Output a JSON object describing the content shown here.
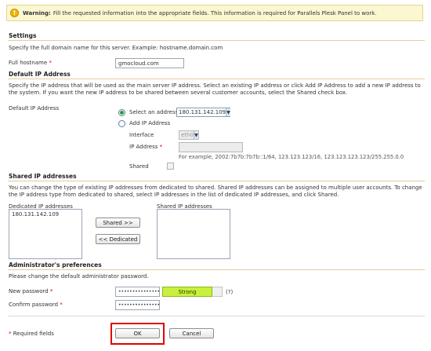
{
  "warning": {
    "title": "Warning:",
    "text": "Fill the requested information into the appropriate fields. This information is required for Parallels Plesk Panel to work."
  },
  "settings": {
    "title": "Settings",
    "description": "Specify the full domain name for this server. Example: hostname.domain.com",
    "hostname_label": "Full hostname",
    "hostname_value": "gmocloud.com"
  },
  "default_ip": {
    "title": "Default IP Address",
    "description": "Specify the IP address that will be used as the main server IP address. Select an existing IP address or click Add IP Address to add a new IP address to the system. If you want the new IP address to be shared between several customer accounts, select the Shared check box.",
    "label": "Default IP Address",
    "select_option_label": "Select an address",
    "selected_address": "180.131.142.109",
    "add_option_label": "Add IP Address",
    "interface_label": "Interface",
    "interface_value": "eth0",
    "ip_label": "IP Address",
    "ip_example": "For example, 2002:7b7b:7b7b::1/64, 123.123.123/16, 123.123.123.123/255.255.0.0",
    "shared_label": "Shared"
  },
  "shared_ips": {
    "title": "Shared IP addresses",
    "description": "You can change the type of existing IP addresses from dedicated to shared. Shared IP addresses can be assigned to multiple user accounts. To change the IP address type from dedicated to shared, select IP addresses in the list of dedicated IP addresses, and click Shared.",
    "dedicated_label": "Dedicated IP addresses",
    "dedicated_items": [
      "180.131.142.109"
    ],
    "shared_label": "Shared IP addresses",
    "to_shared_button": "Shared >>",
    "to_dedicated_button": "<< Dedicated"
  },
  "admin": {
    "title": "Administrator's preferences",
    "description": "Please change the default administrator password.",
    "new_password_label": "New password",
    "new_password_value": "••••••••••••••••",
    "strength_label": "Strong",
    "help_text": "(?)",
    "confirm_password_label": "Confirm password",
    "confirm_password_value": "••••••••••••••••"
  },
  "footer": {
    "required_note": "Required fields",
    "required_mark": "*",
    "ok_button": "OK",
    "cancel_button": "Cancel"
  },
  "colors": {
    "accent_rule": "#e8c9a0",
    "strength_fill": "#c8f03d",
    "radio_selected": "#22a22a",
    "highlight_box": "#e00000"
  }
}
